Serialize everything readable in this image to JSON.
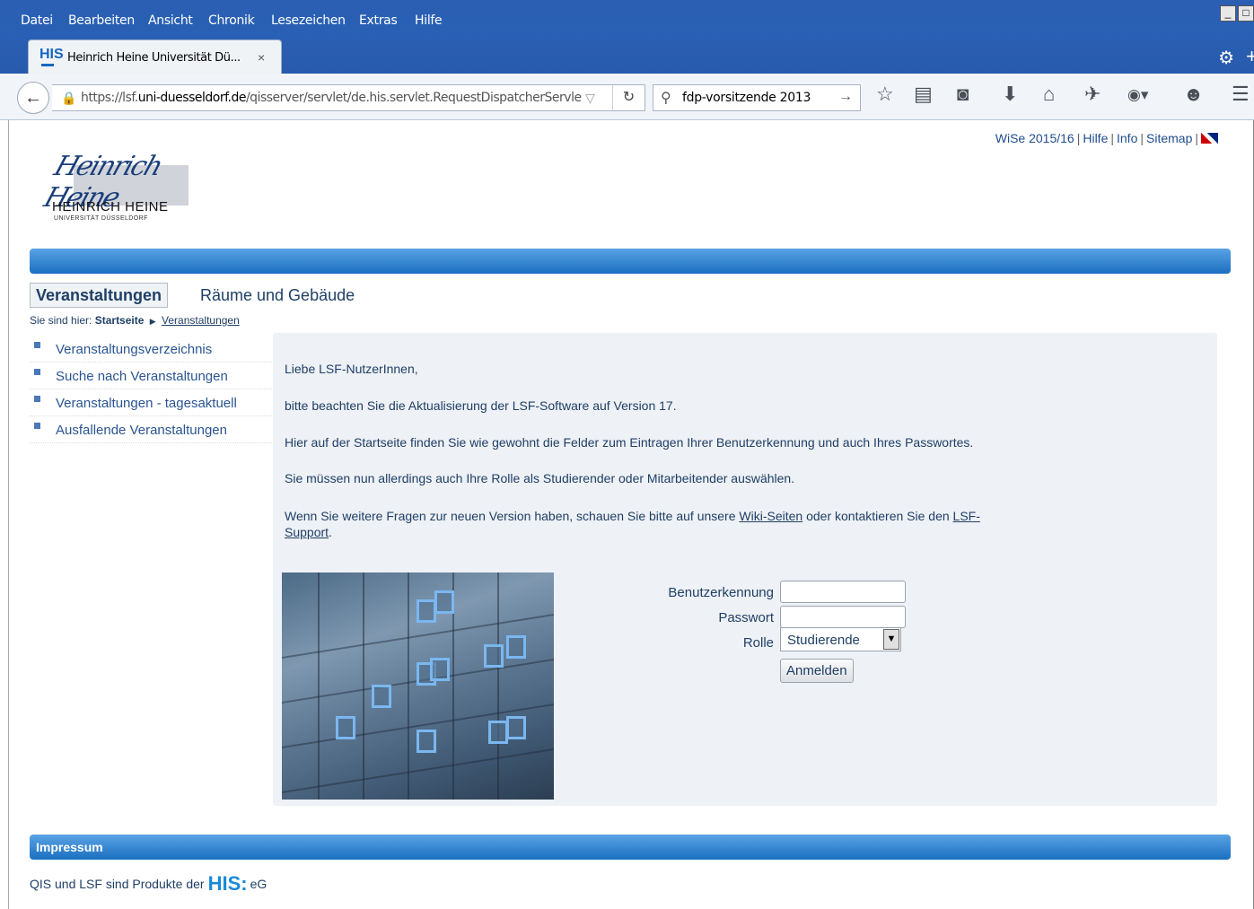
{
  "browser": {
    "menu": [
      "Datei",
      "Bearbeiten",
      "Ansicht",
      "Chronik",
      "Lesezeichen",
      "Extras",
      "Hilfe"
    ],
    "tab": {
      "favicon": "HIS",
      "title": "Heinrich Heine Universität Dü...",
      "close": "×"
    },
    "url": {
      "prefix": "https://lsf.",
      "domain": "uni-duesseldorf.de",
      "path": "/qisserver/servlet/de.his.servlet.RequestDispatcherServle"
    },
    "search": {
      "value": "fdp-vorsitzende 2013"
    },
    "icons": [
      "back-arrow-icon",
      "lock-icon",
      "reload-icon",
      "search-icon",
      "bookmark-star-icon",
      "reading-list-icon",
      "pocket-icon",
      "download-icon",
      "home-icon",
      "send-icon",
      "adblock-icon",
      "chat-icon",
      "hamburger-menu-icon",
      "gear-icon"
    ]
  },
  "top_links": {
    "semester": "WiSe 2015/16",
    "help": "Hilfe",
    "info": "Info",
    "sitemap": "Sitemap"
  },
  "logo": {
    "name": "HEINRICH HEINE",
    "sub": "UNIVERSITÄT DÜSSELDORF"
  },
  "main_tabs": {
    "active": "Veranstaltungen",
    "other": "Räume und Gebäude"
  },
  "breadcrumb": {
    "prefix": "Sie sind hier:",
    "home": "Startseite",
    "current": "Veranstaltungen"
  },
  "sidenav": [
    {
      "label": "Veranstaltungsverzeichnis"
    },
    {
      "label": "Suche nach Veranstaltungen"
    },
    {
      "label": "Veranstaltungen - tagesaktuell"
    },
    {
      "label": "Ausfallende Veranstaltungen"
    }
  ],
  "message": {
    "greeting": "Liebe LSF-NutzerInnen,",
    "p1": "bitte beachten Sie die Aktualisierung der LSF-Software auf Version 17.",
    "p2a": "Hier auf der Startseite finden Sie wie gewohnt die Felder zum Eintragen Ihrer Benutzerkennung und auch Ihres Passwortes.",
    "p2b": "Sie müssen nun allerdings auch Ihre Rolle als Studierender oder Mitarbeitender auswählen.",
    "p3_pre": "Wenn Sie weitere Fragen zur neuen Version haben, schauen Sie bitte auf unsere ",
    "p3_link1": "Wiki-Seiten",
    "p3_mid": " oder kontaktieren Sie den ",
    "p3_link2": "LSF-Support",
    "p3_end": "."
  },
  "login": {
    "user_label": "Benutzerkennung",
    "user_value": "",
    "pass_label": "Passwort",
    "pass_value": "",
    "role_label": "Rolle",
    "role_value": "Studierende",
    "submit": "Anmelden"
  },
  "footer": {
    "title": "Impressum",
    "text_pre": "QIS und LSF sind Produkte der",
    "his": "HIS:",
    "text_post": "eG"
  }
}
